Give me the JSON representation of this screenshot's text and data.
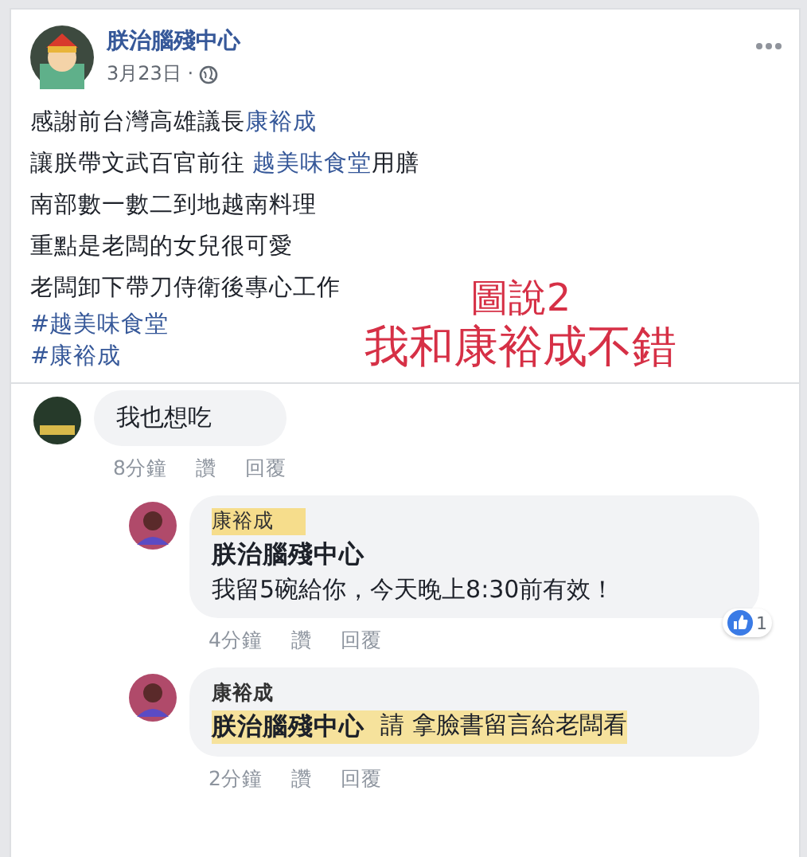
{
  "post": {
    "author": "朕治腦殘中心",
    "date": "3月23日 ·",
    "lines": [
      {
        "segments": [
          {
            "kind": "plain",
            "text": "感謝前台灣高雄議長"
          },
          {
            "kind": "link",
            "text": "康裕成"
          }
        ]
      },
      {
        "segments": [
          {
            "kind": "plain",
            "text": "讓朕帶文武百官前往 "
          },
          {
            "kind": "link",
            "text": "越美味食堂"
          },
          {
            "kind": "plain",
            "text": "用膳"
          }
        ]
      },
      {
        "segments": [
          {
            "kind": "plain",
            "text": "南部數一數二到地越南料理"
          }
        ]
      },
      {
        "segments": [
          {
            "kind": "plain",
            "text": "重點是老闆的女兒很可愛"
          }
        ]
      },
      {
        "segments": [
          {
            "kind": "plain",
            "text": "老闆卸下帶刀侍衛後專心工作"
          }
        ]
      }
    ],
    "hashtags": [
      "#越美味食堂",
      "#康裕成"
    ],
    "caption": [
      "圖說2",
      "我和康裕成不錯"
    ]
  },
  "comments": [
    {
      "kind": "top",
      "lines": [
        {
          "highlighted": false,
          "segments": [
            {
              "kind": "plain",
              "text": "我也想吃"
            }
          ]
        }
      ],
      "meta": [
        "8分鐘",
        "讚",
        "回覆"
      ]
    },
    {
      "kind": "reply",
      "author": "康裕成",
      "author_highlighted": true,
      "lines": [
        {
          "highlighted": false,
          "segments": [
            {
              "kind": "mention",
              "text": "朕治腦殘中心"
            }
          ]
        },
        {
          "highlighted": false,
          "segments": [
            {
              "kind": "plain",
              "text": "我留5碗給你，今天晚上8:30前有效！"
            }
          ]
        }
      ],
      "reactions": "1",
      "meta": [
        "4分鐘",
        "讚",
        "回覆"
      ]
    },
    {
      "kind": "reply",
      "author": "康裕成",
      "author_highlighted": false,
      "lines": [
        {
          "highlighted": true,
          "segments": [
            {
              "kind": "mention",
              "text": "朕治腦殘中心"
            },
            {
              "kind": "plain",
              "text": "請 拿臉書留言給老闆看"
            }
          ]
        }
      ],
      "meta": [
        "2分鐘",
        "讚",
        "回覆"
      ]
    }
  ]
}
